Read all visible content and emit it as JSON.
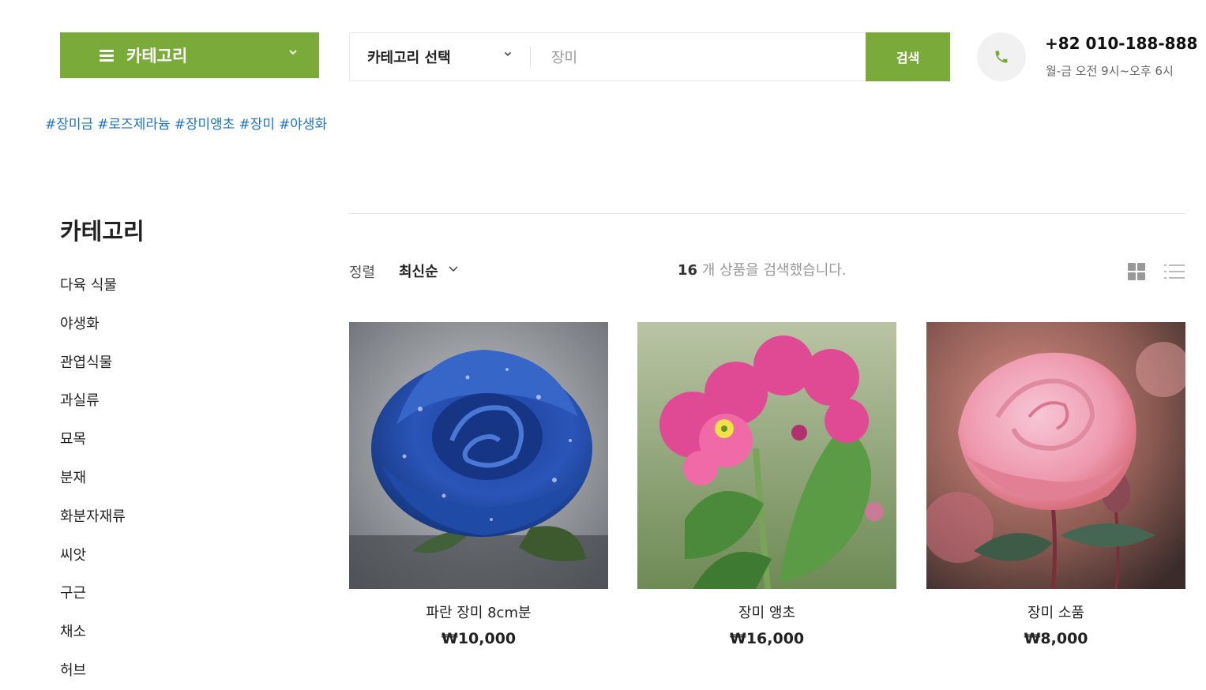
{
  "header": {
    "category_button": "카테고리",
    "search_select": "카테고리 선택",
    "search_value": "장미",
    "search_button": "검색",
    "phone": "+82 010-188-888",
    "hours": "월-금 오전 9시~오후 6시"
  },
  "tags": [
    "#장미금",
    "#로즈제라늄",
    "#장미앵초",
    "#장미",
    "#야생화"
  ],
  "sidebar": {
    "title": "카테고리",
    "items": [
      {
        "label": "다육 식물"
      },
      {
        "label": "야생화"
      },
      {
        "label": "관엽식물"
      },
      {
        "label": "과실류"
      },
      {
        "label": "묘목"
      },
      {
        "label": "분재"
      },
      {
        "label": "화분자재류"
      },
      {
        "label": "씨앗"
      },
      {
        "label": "구근"
      },
      {
        "label": "채소"
      },
      {
        "label": "허브"
      }
    ]
  },
  "toolbar": {
    "sort_label": "정렬",
    "sort_value": "최신순",
    "result_count": "16",
    "result_text": " 개 상품을 검색했습니다."
  },
  "products": [
    {
      "name": "파란 장미 8cm분",
      "price": "₩10,000"
    },
    {
      "name": "장미 앵초",
      "price": "₩16,000"
    },
    {
      "name": "장미 소품",
      "price": "₩8,000"
    }
  ],
  "colors": {
    "accent": "#7aab3a",
    "tag_link": "#1a73c8"
  },
  "icons": [
    "menu-icon",
    "chevron-down-icon",
    "phone-icon",
    "grid-view-icon",
    "list-view-icon"
  ]
}
